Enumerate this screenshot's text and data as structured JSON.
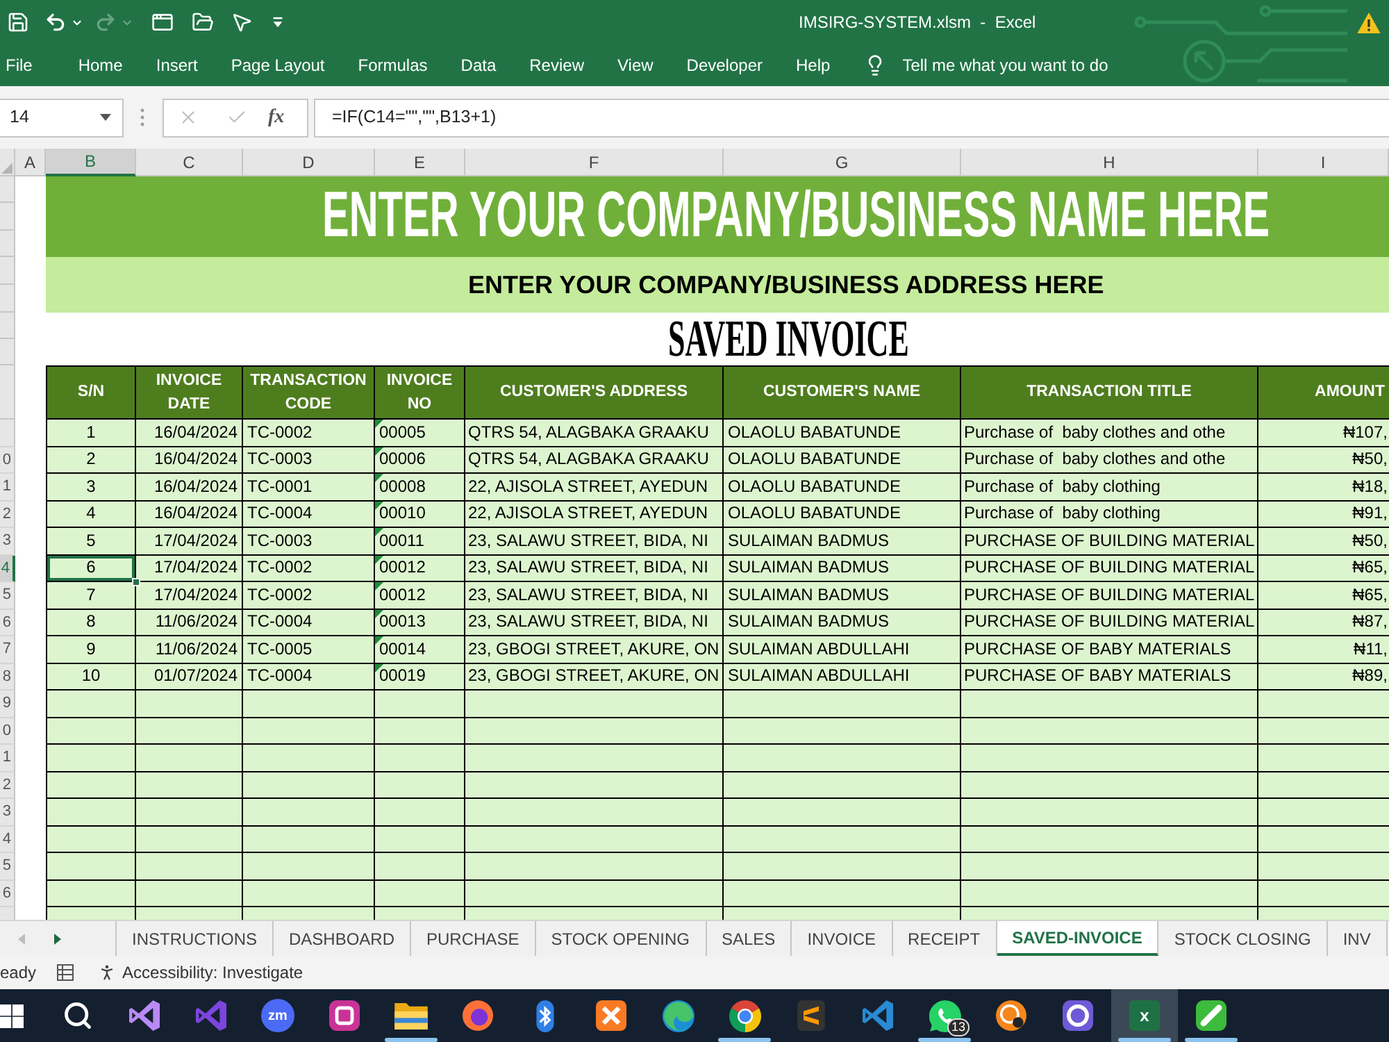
{
  "window": {
    "title": "IMSIRG-SYSTEM.xlsm  -  Excel",
    "quick_access": {
      "redo_disabled": true
    }
  },
  "ribbon": {
    "tabs": [
      {
        "label": "File",
        "selected": false
      },
      {
        "label": "Home",
        "selected": false
      },
      {
        "label": "Insert",
        "selected": false
      },
      {
        "label": "Page Layout",
        "selected": false
      },
      {
        "label": "Formulas",
        "selected": false
      },
      {
        "label": "Data",
        "selected": false
      },
      {
        "label": "Review",
        "selected": false
      },
      {
        "label": "View",
        "selected": false
      },
      {
        "label": "Developer",
        "selected": false
      },
      {
        "label": "Help",
        "selected": false
      }
    ],
    "tell_me": "Tell me what you want to do"
  },
  "formula_bar": {
    "name_box": "14",
    "editing": false,
    "function_label": "fx",
    "formula": "=IF(C14=\"\",\"\",B13+1)"
  },
  "sheet": {
    "column_letters": [
      {
        "label": "A",
        "selected": false
      },
      {
        "label": "B",
        "selected": true
      },
      {
        "label": "C",
        "selected": false
      },
      {
        "label": "D",
        "selected": false
      },
      {
        "label": "E",
        "selected": false
      },
      {
        "label": "F",
        "selected": false
      },
      {
        "label": "G",
        "selected": false
      },
      {
        "label": "H",
        "selected": false
      },
      {
        "label": "I",
        "selected": false
      }
    ],
    "row_labels": [
      "0",
      "1",
      "2",
      "3",
      "4",
      "5",
      "6",
      "7",
      "8",
      "9",
      "0",
      "1",
      "2",
      "3",
      "4",
      "5",
      "6"
    ],
    "company_name": "ENTER YOUR COMPANY/BUSINESS NAME HERE",
    "company_address": "ENTER YOUR COMPANY/BUSINESS ADDRESS HERE",
    "title": "SAVED INVOICE",
    "table": {
      "columns": [
        "S/N",
        "INVOICE DATE",
        "TRANSACTION CODE",
        "INVOICE NO",
        "CUSTOMER'S ADDRESS",
        "CUSTOMER'S NAME",
        "TRANSACTION TITLE",
        "AMOUNT"
      ],
      "rows": [
        {
          "sn": "1",
          "invoice_date": "16/04/2024",
          "transaction_code": "TC-0002",
          "invoice_no": "00005",
          "customer_address": "QTRS 54, ALAGBAKA GRAAKU",
          "customer_name": "OLAOLU BABATUNDE",
          "transaction_title": "Purchase of  baby clothes and othe",
          "amount": "₦107,",
          "error_flag": true,
          "selected": false
        },
        {
          "sn": "2",
          "invoice_date": "16/04/2024",
          "transaction_code": "TC-0003",
          "invoice_no": "00006",
          "customer_address": "QTRS 54, ALAGBAKA GRAAKU",
          "customer_name": "OLAOLU BABATUNDE",
          "transaction_title": "Purchase of  baby clothes and othe",
          "amount": "₦50,",
          "error_flag": true,
          "selected": false
        },
        {
          "sn": "3",
          "invoice_date": "16/04/2024",
          "transaction_code": "TC-0001",
          "invoice_no": "00008",
          "customer_address": "22, AJISOLA STREET, AYEDUN",
          "customer_name": "OLAOLU BABATUNDE",
          "transaction_title": "Purchase of  baby clothing",
          "amount": "₦18,",
          "error_flag": true,
          "selected": false
        },
        {
          "sn": "4",
          "invoice_date": "16/04/2024",
          "transaction_code": "TC-0004",
          "invoice_no": "00010",
          "customer_address": "22, AJISOLA STREET, AYEDUN",
          "customer_name": "OLAOLU BABATUNDE",
          "transaction_title": "Purchase of  baby clothing",
          "amount": "₦91,",
          "error_flag": true,
          "selected": false
        },
        {
          "sn": "5",
          "invoice_date": "17/04/2024",
          "transaction_code": "TC-0003",
          "invoice_no": "00011",
          "customer_address": "23, SALAWU STREET, BIDA, NI",
          "customer_name": "SULAIMAN BADMUS",
          "transaction_title": "PURCHASE OF BUILDING MATERIAL",
          "amount": "₦50,",
          "error_flag": true,
          "selected": false
        },
        {
          "sn": "6",
          "invoice_date": "17/04/2024",
          "transaction_code": "TC-0002",
          "invoice_no": "00012",
          "customer_address": "23, SALAWU STREET, BIDA, NI",
          "customer_name": "SULAIMAN BADMUS",
          "transaction_title": "PURCHASE OF BUILDING MATERIAL",
          "amount": "₦65,",
          "error_flag": true,
          "selected": true
        },
        {
          "sn": "7",
          "invoice_date": "17/04/2024",
          "transaction_code": "TC-0002",
          "invoice_no": "00012",
          "customer_address": "23, SALAWU STREET, BIDA, NI",
          "customer_name": "SULAIMAN BADMUS",
          "transaction_title": "PURCHASE OF BUILDING MATERIAL",
          "amount": "₦65,",
          "error_flag": true,
          "selected": false
        },
        {
          "sn": "8",
          "invoice_date": "11/06/2024",
          "transaction_code": "TC-0004",
          "invoice_no": "00013",
          "customer_address": "23, SALAWU STREET, BIDA, NI",
          "customer_name": "SULAIMAN BADMUS",
          "transaction_title": "PURCHASE OF BUILDING MATERIAL",
          "amount": "₦87,",
          "error_flag": true,
          "selected": false
        },
        {
          "sn": "9",
          "invoice_date": "11/06/2024",
          "transaction_code": "TC-0005",
          "invoice_no": "00014",
          "customer_address": "23, GBOGI STREET, AKURE, ON",
          "customer_name": "SULAIMAN ABDULLAHI",
          "transaction_title": "PURCHASE OF BABY MATERIALS",
          "amount": "₦11,",
          "error_flag": true,
          "selected": false
        },
        {
          "sn": "10",
          "invoice_date": "01/07/2024",
          "transaction_code": "TC-0004",
          "invoice_no": "00019",
          "customer_address": "23, GBOGI STREET, AKURE, ON",
          "customer_name": "SULAIMAN ABDULLAHI",
          "transaction_title": "PURCHASE OF BABY MATERIALS",
          "amount": "₦89,",
          "error_flag": true,
          "selected": false
        }
      ]
    }
  },
  "sheet_tabs": {
    "scroll_left_disabled": true,
    "scroll_right_disabled": false,
    "tabs": [
      {
        "label": "INSTRUCTIONS",
        "selected": false
      },
      {
        "label": "DASHBOARD",
        "selected": false
      },
      {
        "label": "PURCHASE",
        "selected": false
      },
      {
        "label": "STOCK OPENING",
        "selected": false
      },
      {
        "label": "SALES",
        "selected": false
      },
      {
        "label": "INVOICE",
        "selected": false
      },
      {
        "label": "RECEIPT",
        "selected": false
      },
      {
        "label": "SAVED-INVOICE",
        "selected": true
      },
      {
        "label": "STOCK CLOSING",
        "selected": false
      },
      {
        "label": "INV",
        "selected": false
      }
    ]
  },
  "status_bar": {
    "mode": "eady",
    "accessibility": "Accessibility: Investigate"
  },
  "taskbar": {
    "apps": [
      {
        "kind": "start",
        "running": false,
        "selected": false
      },
      {
        "kind": "search",
        "running": false,
        "selected": false
      },
      {
        "kind": "loop",
        "running": false,
        "selected": false
      },
      {
        "kind": "knot",
        "running": false,
        "selected": false
      },
      {
        "kind": "disc",
        "label": "zm",
        "running": false,
        "selected": false
      },
      {
        "kind": "tile",
        "running": false,
        "selected": false
      },
      {
        "kind": "folder",
        "running": true,
        "selected": false
      },
      {
        "kind": "fox",
        "running": false,
        "selected": false
      },
      {
        "kind": "bluetooth",
        "running": false,
        "selected": false
      },
      {
        "kind": "cross",
        "running": false,
        "selected": false
      },
      {
        "kind": "swirl",
        "running": false,
        "selected": false
      },
      {
        "kind": "wheel",
        "running": true,
        "selected": false
      },
      {
        "kind": "stripes",
        "running": false,
        "selected": false
      },
      {
        "kind": "ribbon",
        "running": false,
        "selected": false
      },
      {
        "kind": "chat",
        "badge": "13",
        "running": true,
        "selected": false
      },
      {
        "kind": "target",
        "running": false,
        "selected": false
      },
      {
        "kind": "ring",
        "running": false,
        "selected": false
      },
      {
        "kind": "sheet",
        "label": "x",
        "running": true,
        "selected": true
      },
      {
        "kind": "slash",
        "running": true,
        "selected": false
      }
    ]
  }
}
